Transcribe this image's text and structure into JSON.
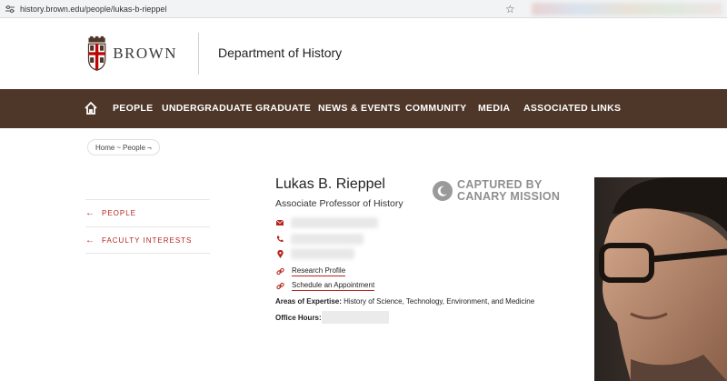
{
  "browser": {
    "url": "history.brown.edu/people/lukas-b-rieppel",
    "icons": [
      "tune-icon",
      "star-icon"
    ]
  },
  "header": {
    "logo_text": "BROWN",
    "dept_title": "Department of History"
  },
  "nav": {
    "items": [
      "PEOPLE",
      "UNDERGRADUATE",
      "GRADUATE",
      "NEWS & EVENTS",
      "COMMUNITY",
      "MEDIA",
      "ASSOCIATED LINKS"
    ],
    "background": "#4e3629"
  },
  "breadcrumb": {
    "home": "Home",
    "sep1": "~",
    "people": "People",
    "sep2": "¬"
  },
  "sidenav": {
    "items": [
      "PEOPLE",
      "FACULTY INTERESTS"
    ],
    "accent": "#b5261e"
  },
  "profile": {
    "name": "Lukas B. Rieppel",
    "title": "Associate Professor of History",
    "links": [
      "Research Profile",
      "Schedule an Appointment"
    ],
    "expertise_label": "Areas of Expertise:",
    "expertise_value": "History of Science, Technology, Environment, and Medicine",
    "office_label": "Office Hours:"
  },
  "watermark": {
    "line1": "CAPTURED BY",
    "line2": "CANARY MISSION"
  }
}
